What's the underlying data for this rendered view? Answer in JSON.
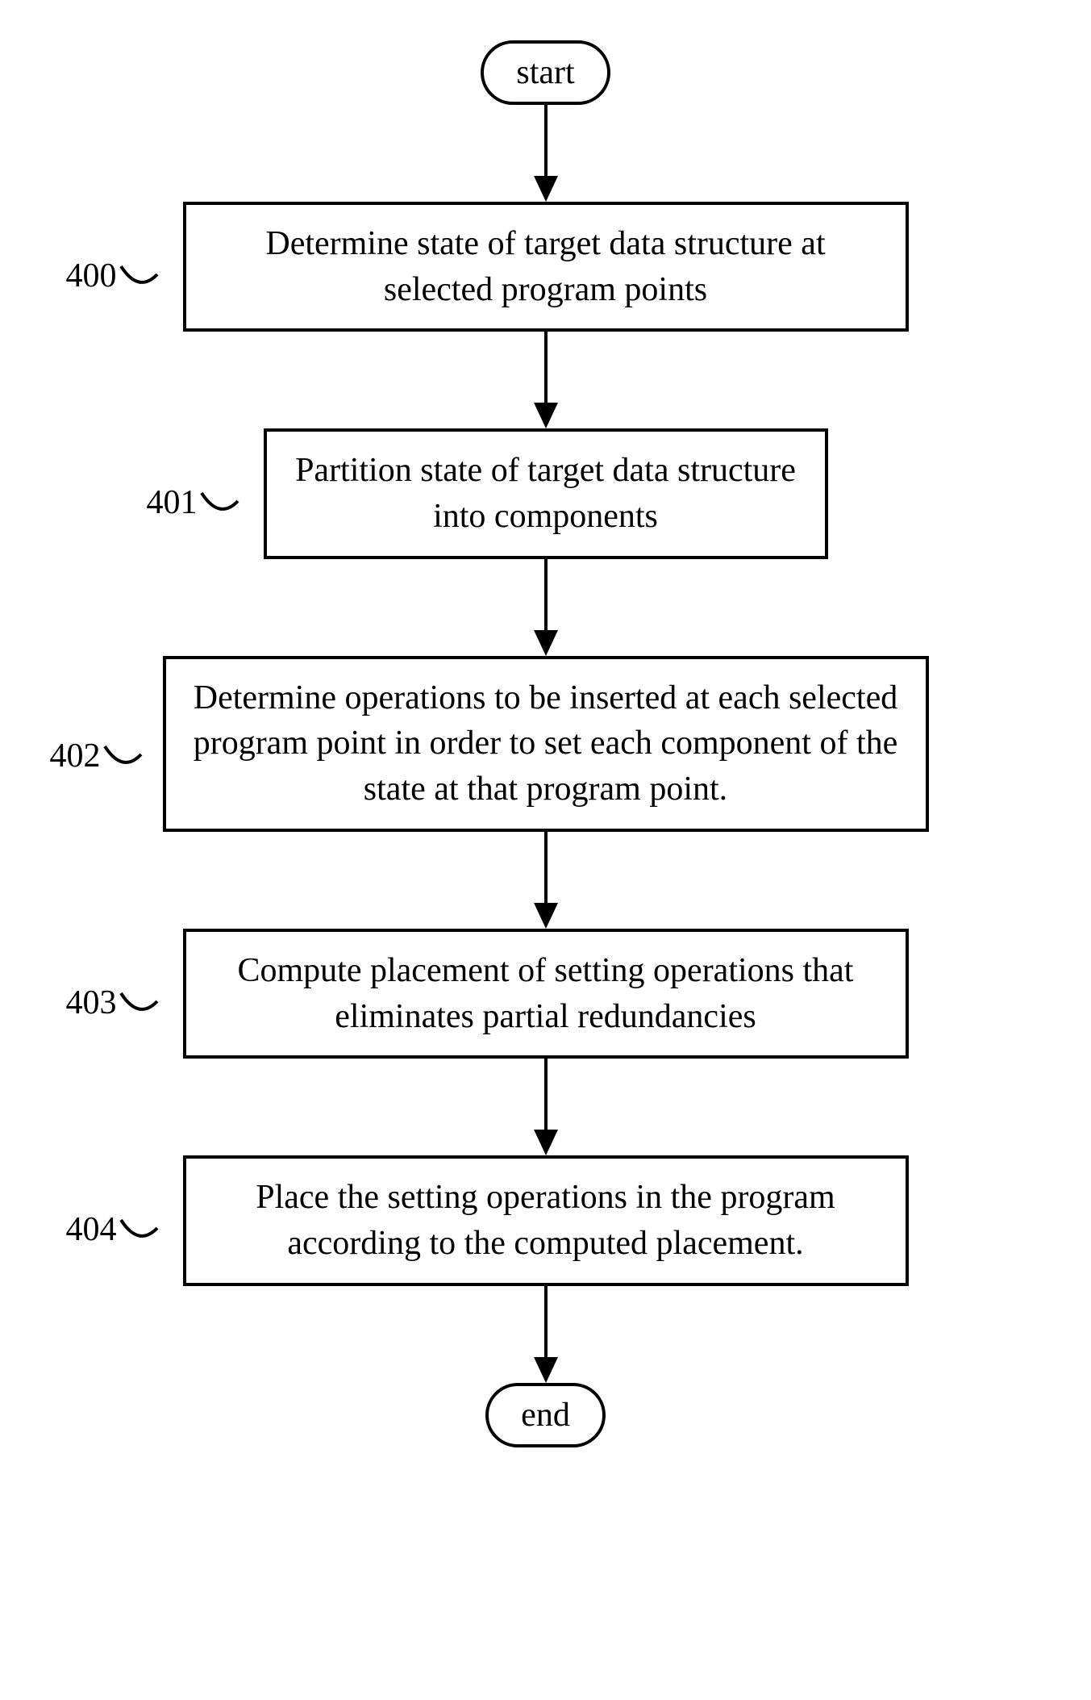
{
  "terminals": {
    "start": "start",
    "end": "end"
  },
  "steps": {
    "s400": {
      "ref": "400",
      "text": "Determine state of target data structure at selected program points"
    },
    "s401": {
      "ref": "401",
      "text": "Partition state of target data structure into components"
    },
    "s402": {
      "ref": "402",
      "text": "Determine operations to be inserted at each selected program point in order to set each component of the state at that program point."
    },
    "s403": {
      "ref": "403",
      "text": "Compute placement of setting operations that eliminates partial redundancies"
    },
    "s404": {
      "ref": "404",
      "text": "Place the setting operations in the program according to the computed placement."
    }
  }
}
